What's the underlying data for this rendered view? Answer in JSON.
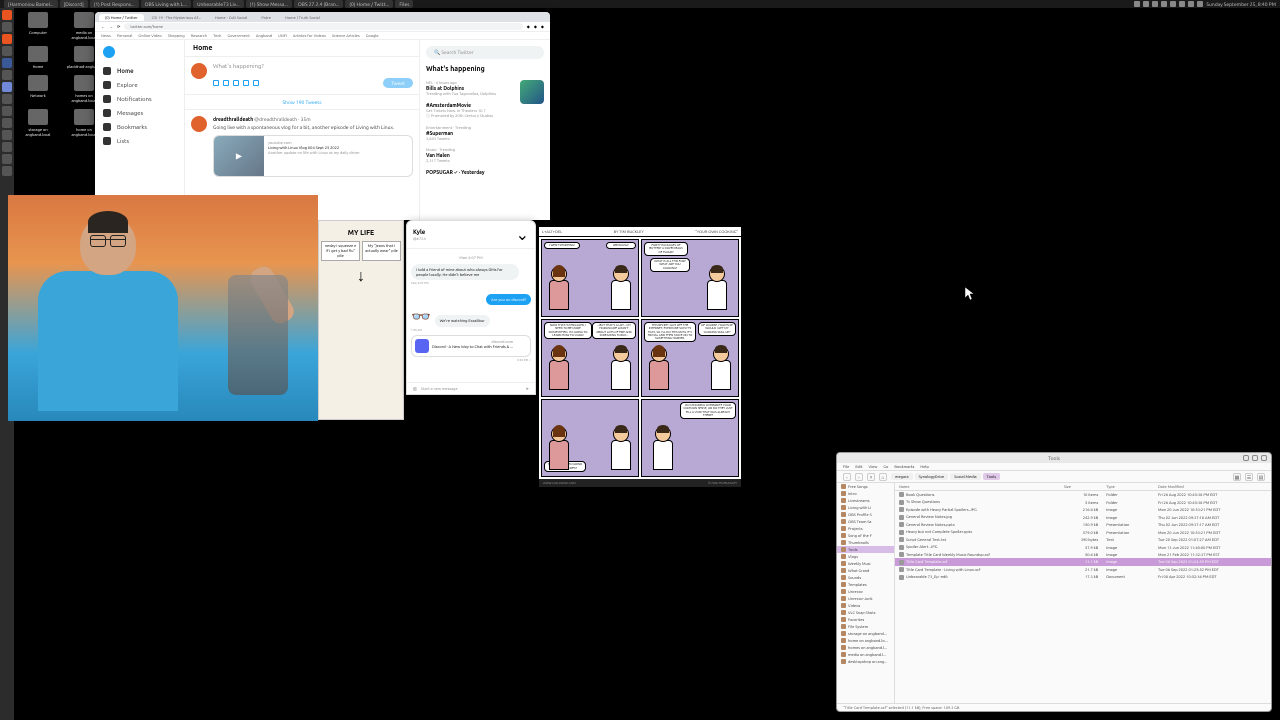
{
  "topbar": {
    "tabs": [
      "[Harmoniou Bamel...",
      "[Discord]",
      "(1) Post Respons...",
      "OBS Living with L...",
      "Unbearable73 Liv...",
      "(1) Show Messa...",
      "OBS 27.2.4 (Bran...",
      "(0) Home / Twitt...",
      "Files"
    ],
    "clock": "Sunday September 25, 8:40 PM"
  },
  "desktop": {
    "icons": [
      "Computer",
      "media on angband.local",
      "Home",
      "placidnod-angband",
      "Network",
      "homes on angband.local",
      "storage on angband.local",
      "home on angband.local"
    ]
  },
  "browser": {
    "tabs": [
      "(0) Home / Twitter",
      "CSI 19 - The Mysterious Af...",
      "Home - Cult Social",
      "Patre",
      "Home | Truth Social"
    ],
    "url": "twitter.com/home",
    "bookmarks": [
      "News",
      "Personal",
      "Online Video",
      "Shopping",
      "Research",
      "Tech",
      "Government",
      "Angband",
      "UNFI",
      "Articles for Videos",
      "Science Articles",
      "Google"
    ]
  },
  "twitter": {
    "nav": [
      "Home",
      "Explore",
      "Notifications",
      "Messages",
      "Bookmarks",
      "Lists"
    ],
    "header": "Home",
    "compose_placeholder": "What's happening?",
    "tweet_btn": "Tweet",
    "show_tweets": "Show 190 Tweets",
    "tweet": {
      "author": "dreadthralldeath",
      "handle": "@dreadthralldeath · 35m",
      "text": "Going live with a spontaneous vlog for a bit, another episode of Living with Linux.",
      "card_domain": "youtube.com",
      "card_title": "Living with Linux Vlog 004 Sept 25 2022",
      "card_desc": "Another update on life with Linux as my daily driver"
    },
    "search": "Search Twitter",
    "happening": "What's happening",
    "trends": [
      {
        "cat": "NFL · 4 hours ago",
        "name": "Bills at Dolphins",
        "meta": "Trending with Tua Tagovailoa, Dolphins"
      },
      {
        "cat": "",
        "name": "#AmsterdamMovie",
        "meta": "Get Tickets Now. In Theaters 10.7",
        "promo": "Promoted by 20th Century Studios"
      },
      {
        "cat": "Entertainment · Trending",
        "name": "#Superman",
        "meta": "3,883 Tweets"
      },
      {
        "cat": "Music · Trending",
        "name": "Van Halen",
        "meta": "2,317 Tweets"
      },
      {
        "cat": "",
        "name": "POPSUGAR ✓ · Yesterday",
        "meta": ""
      }
    ]
  },
  "meme": {
    "title": "MY LIFE",
    "col1": "neday I squeeze e if I get y bad flu\" pile",
    "col2": "My \"jeans that I actually wear\" pile"
  },
  "dm": {
    "name": "Kyle",
    "handle": "@e724",
    "time1": "Mon 4:07 PM",
    "msg1": "I told a friend of mine about who always DMs for people locally. He didn't believe me",
    "stamp1": "Mon 4:07 PM",
    "msg2": "Are you on discord?",
    "msg3": "We're watching Excalibur",
    "stamp3": "1:36 AM",
    "card_domain": "discord.com",
    "card_title": "Discord - A New Way to Chat with Friends & ...",
    "stamp4": "6:28 PM ✓",
    "input": "Start a new message"
  },
  "comic": {
    "title_left": "L+ALT+DEL",
    "title_mid": "BY TIM BUCKLEY",
    "title_right": "\"YOUR OWN COOKING\"",
    "p1a": "I WENT SHOPPING!",
    "p1b": "OBVIOUSLY.",
    "p2a": "FORTY PACKAGES OF BUTTER? A DOZEN BAGS OF FLOUR?",
    "p2b": "WHAT IS ALL THIS FOR? WHAT ARE YOU COOKING?",
    "p3a": "NOW THAT I'M ENGAGED, I NEED TO BE MORE DOMESTIFIED. I'M GOING TO LEARN HOW TO COOK!",
    "p3b": "...BUT THAT'S A LOT... MY HOROSCOPE WASN'T ABOUT LOTS OF FIRE AND SCREAMING TODAY...",
    "p4a": "THIS RECIPE I GOT OFF THE INTERNET. EVERYONE SAYS IT'S EASY, SO I'LL DO THIS UNTIL IT'S TRIVIAL AND THEN MOVE ON TO SOMETHING HARDER.",
    "p4b": "OF COURSE. HOW ELSE WOULD I GET MY COOKING SKILL UP?",
    "p5a": "YOU'RE GOING TO GRIND BAKING RECIPES?",
    "p5b": "DO MMORPGS OVERWRITE YOUR COMMON SENSE, OR DO THEY JUST FILL A VOID THAT WAS ALREADY THERE?",
    "footer_left": "WWW.CAD-COMIC.COM",
    "footer_right": "© 2008 TIM BUCKLEY"
  },
  "fm": {
    "title": "Tools",
    "menu": [
      "File",
      "Edit",
      "View",
      "Go",
      "Bookmarks",
      "Help"
    ],
    "path": [
      "megara",
      "SynologyDrive",
      "Social Media",
      "Tools"
    ],
    "sidebar_places": [
      "Free Songs",
      "Intro",
      "Livestreams",
      "Living with Li",
      "OBS Profile S",
      "OBS Team Sa",
      "Projects",
      "Song of the F",
      "Thumbnails",
      "Tools",
      "Vlogs",
      "Weekly Musi",
      "What Grand",
      "Sounds",
      "Templates",
      "Unrecov",
      "Unrecov-Junk",
      "Videos",
      "VLC Snap Shots",
      "Favorites",
      "File System",
      "storage on angband...",
      "home on angband.lo...",
      "homes on angband.l...",
      "media on angband.l...",
      "desktopdrop on ang..."
    ],
    "sidebar_selected": "Tools",
    "columns": [
      "Name",
      "Size",
      "Type",
      "Date Modified"
    ],
    "files": [
      {
        "n": "Book Questions",
        "s": "10 items",
        "t": "Folder",
        "d": "Fri 26 Aug 2022 10:45:38 PM EDT"
      },
      {
        "n": "Tv Show Questions",
        "s": "5 items",
        "t": "Folder",
        "d": "Fri 26 Aug 2022 10:45:38 PM EDT"
      },
      {
        "n": "Episode with Heavy Partial Spoilers.JPG",
        "s": "216.6 kB",
        "t": "Image",
        "d": "Mon 20 Jun 2022 10:53:21 PM EDT"
      },
      {
        "n": "General Review Notes.jpg",
        "s": "242.9 kB",
        "t": "Image",
        "d": "Thu 02 Jun 2022 09:37:18 AM EDT"
      },
      {
        "n": "General Review Notes.pptx",
        "s": "150.9 kB",
        "t": "Presentation",
        "d": "Thu 02 Jun 2022 09:37:17 AM EDT"
      },
      {
        "n": "Heavy but not Complete Spoiler.pptx",
        "s": "579.0 kB",
        "t": "Presentation",
        "d": "Mon 20 Jun 2022 10:53:21 PM EDT"
      },
      {
        "n": "Script General Text.txt",
        "s": "390 bytes",
        "t": "Text",
        "d": "Tue 20 Sep 2022 01:07:27 AM EDT"
      },
      {
        "n": "Spoiler Alert .JPG",
        "s": "57.9 kB",
        "t": "Image",
        "d": "Mon 13 Jun 2022 11:40:00 PM EDT"
      },
      {
        "n": "Template Title Card Weekly Music Roundup.xcf",
        "s": "50.6 kB",
        "t": "Image",
        "d": "Mon 21 Feb 2022 11:32:37 PM EST"
      },
      {
        "n": "Title Card Template.xcf",
        "s": "11.1 kB",
        "t": "Image",
        "d": "Tue 06 Sep 2022 01:24:59 PM EDT",
        "sel": true
      },
      {
        "n": "Title Card Template - Living with Linux.xcf",
        "s": "21.7 kB",
        "t": "Image",
        "d": "Tue 06 Sep 2022 01:25:52 PM EDT"
      },
      {
        "n": "Unbearable 73_Ep -edit",
        "s": "17.3 kB",
        "t": "Document",
        "d": "Fri 08 Apr 2022 10:52:36 PM EDT"
      }
    ],
    "status": "\"Title Card Template.xcf\" selected (11.1 kB), Free space: 189.3 GB"
  }
}
